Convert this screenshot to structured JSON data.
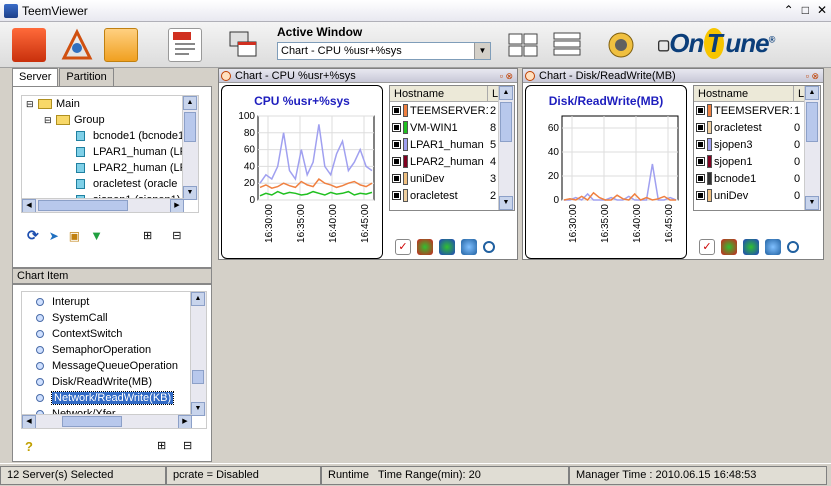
{
  "window": {
    "title": "TeemViewer",
    "controls": [
      "⌃",
      "□",
      "✕"
    ]
  },
  "toolbar": {
    "active_window_label": "Active Window",
    "active_window_value": "Chart - CPU %usr+%sys",
    "logo_prefix": "On",
    "logo_t": "T",
    "logo_suffix": "une",
    "logo_reg": "®"
  },
  "left": {
    "tabs": [
      "Server",
      "Partition"
    ],
    "tree": [
      {
        "label": "Main",
        "indent": 0,
        "icon": "folder-open-icon"
      },
      {
        "label": "Group",
        "indent": 1,
        "icon": "folder-open-icon"
      },
      {
        "label": "bcnode1 (bcnode1",
        "indent": 2,
        "icon": "server-icon"
      },
      {
        "label": "LPAR1_human (LP",
        "indent": 2,
        "icon": "server-icon"
      },
      {
        "label": "LPAR2_human (LP",
        "indent": 2,
        "icon": "server-icon"
      },
      {
        "label": "oracletest (oracle",
        "indent": 2,
        "icon": "server-icon"
      },
      {
        "label": "sjopen1 (sjopen1)",
        "indent": 2,
        "icon": "server-icon"
      }
    ],
    "chart_item_header": "Chart Item",
    "chart_items": [
      "Interupt",
      "SystemCall",
      "ContextSwitch",
      "SemaphorOperation",
      "MessageQueueOperation",
      "Disk/ReadWrite(MB)",
      "Network/ReadWrite(KB)",
      "Network/Xfer"
    ],
    "chart_item_selected": 6,
    "help_icon": "?"
  },
  "cpu_window": {
    "title": "Chart - CPU %usr+%sys",
    "chart_title": "CPU %usr+%sys",
    "host_header": [
      "Hostname",
      "L"
    ],
    "hosts": [
      {
        "name": "TEEMSERVER1",
        "value": "2",
        "color": "#f08040"
      },
      {
        "name": "VM-WIN1",
        "value": "8",
        "color": "#20c020"
      },
      {
        "name": "LPAR1_human",
        "value": "5",
        "color": "#a0a0f0"
      },
      {
        "name": "LPAR2_human",
        "value": "4",
        "color": "#800020"
      },
      {
        "name": "uniDev",
        "value": "3",
        "color": "#f0c080"
      },
      {
        "name": "oracletest",
        "value": "2",
        "color": "#f0d0a0"
      }
    ]
  },
  "disk_window": {
    "title": "Chart - Disk/ReadWrite(MB)",
    "chart_title": "Disk/ReadWrite(MB)",
    "host_header": [
      "Hostname",
      "L"
    ],
    "hosts": [
      {
        "name": "TEEMSERVER1",
        "value": "1",
        "color": "#f08040"
      },
      {
        "name": "oracletest",
        "value": "0",
        "color": "#f0d0a0"
      },
      {
        "name": "sjopen3",
        "value": "0",
        "color": "#a0a0f0"
      },
      {
        "name": "sjopen1",
        "value": "0",
        "color": "#800020"
      },
      {
        "name": "bcnode1",
        "value": "0",
        "color": "#303030"
      },
      {
        "name": "uniDev",
        "value": "0",
        "color": "#f0c080"
      }
    ]
  },
  "chart_data": [
    {
      "type": "line",
      "title": "CPU %usr+%sys",
      "ylim": [
        0,
        100
      ],
      "yticks": [
        "100",
        "80",
        "60",
        "40",
        "20",
        "0"
      ],
      "xticks": [
        "16:30:00",
        "16:35:00",
        "16:40:00",
        "16:45:00"
      ],
      "series": [
        {
          "color": "#a0a0f0",
          "values": [
            20,
            30,
            25,
            40,
            80,
            35,
            25,
            60,
            30,
            45,
            90,
            40,
            30,
            55,
            70,
            35,
            45,
            60,
            40,
            35
          ]
        },
        {
          "color": "#f08040",
          "values": [
            15,
            18,
            14,
            16,
            20,
            17,
            15,
            22,
            18,
            16,
            25,
            20,
            18,
            15,
            17,
            20,
            22,
            18,
            16,
            20
          ]
        },
        {
          "color": "#20c020",
          "values": [
            5,
            8,
            6,
            10,
            7,
            9,
            8,
            6,
            7,
            10,
            8,
            6,
            9,
            7,
            8,
            10,
            6,
            8,
            7,
            9
          ]
        }
      ]
    },
    {
      "type": "line",
      "title": "Disk/ReadWrite(MB)",
      "ylim": [
        0,
        70
      ],
      "yticks": [
        "60",
        "40",
        "20",
        "0"
      ],
      "xticks": [
        "16:30:00",
        "16:35:00",
        "16:40:00",
        "16:45:00"
      ],
      "series": [
        {
          "color": "#a0a0f0",
          "values": [
            0,
            0,
            2,
            0,
            5,
            0,
            0,
            0,
            2,
            0,
            0,
            3,
            0,
            0,
            0,
            30,
            0,
            0,
            2,
            0
          ]
        },
        {
          "color": "#f08040",
          "values": [
            0,
            1,
            0,
            3,
            0,
            6,
            2,
            0,
            0,
            4,
            1,
            0,
            5,
            0,
            2,
            0,
            1,
            3,
            0,
            0
          ]
        }
      ]
    }
  ],
  "status": {
    "selected": "12 Server(s) Selected",
    "pcrate": "pcrate = Disabled",
    "runtime": "Runtime",
    "time_range": "Time Range(min): 20",
    "manager_time": "Manager Time : 2010.06.15 16:48:53"
  }
}
